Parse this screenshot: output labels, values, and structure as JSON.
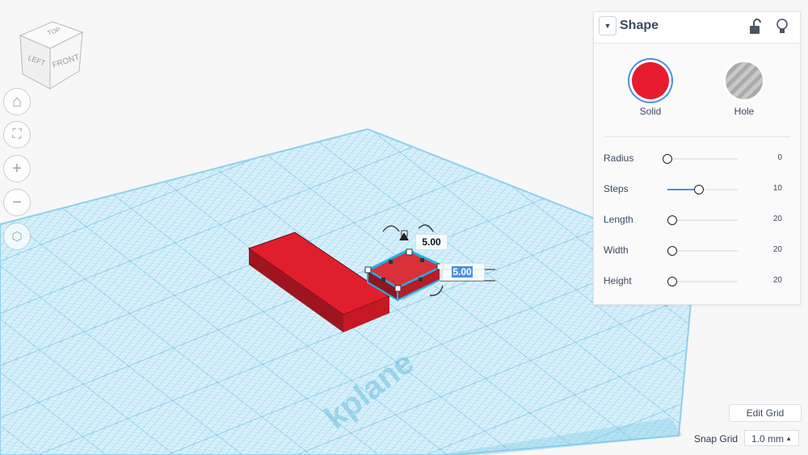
{
  "viewcube": {
    "top": "TOP",
    "left": "LEFT",
    "front": "FRONT"
  },
  "nav_buttons": [
    "home-view",
    "fit-view",
    "zoom-in",
    "zoom-out",
    "ortho-perspective"
  ],
  "workplane": {
    "watermark": "kplane"
  },
  "selection": {
    "height_value": "5.00",
    "elevation_value": "5.00"
  },
  "shape_panel": {
    "title": "Shape",
    "solid_label": "Solid",
    "hole_label": "Hole",
    "solid_color": "#e61b2e",
    "params": [
      {
        "label": "Radius",
        "value": "0",
        "fraction": 0.0
      },
      {
        "label": "Steps",
        "value": "10",
        "fraction": 0.45
      },
      {
        "label": "Length",
        "value": "20",
        "fraction": 0.07
      },
      {
        "label": "Width",
        "value": "20",
        "fraction": 0.07
      },
      {
        "label": "Height",
        "value": "20",
        "fraction": 0.07
      }
    ]
  },
  "footer": {
    "edit_grid_label": "Edit Grid",
    "snap_grid_label": "Snap Grid",
    "snap_grid_value": "1.0 mm"
  }
}
